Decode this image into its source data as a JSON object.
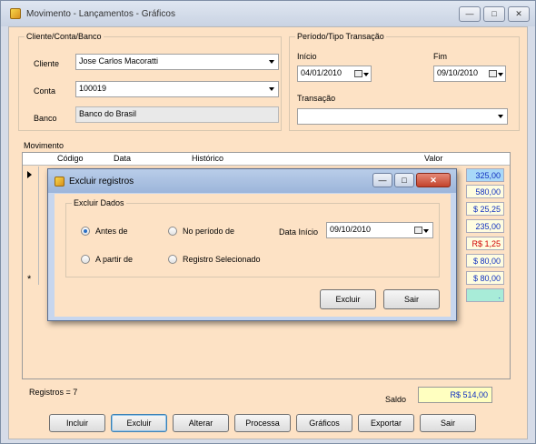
{
  "window": {
    "title": "Movimento - Lançamentos - Gráficos",
    "minimize": "—",
    "maximize": "□",
    "close": "✕"
  },
  "cliente_group": {
    "title": "Cliente/Conta/Banco",
    "cliente_label": "Cliente",
    "cliente_value": "Jose Carlos Macoratti",
    "conta_label": "Conta",
    "conta_value": "100019",
    "banco_label": "Banco",
    "banco_value": "Banco do Brasil"
  },
  "periodo_group": {
    "title": "Período/Tipo Transação",
    "inicio_label": "Início",
    "inicio_value": "04/01/2010",
    "fim_label": "Fim",
    "fim_value": "09/10/2010",
    "transacao_label": "Transação",
    "transacao_value": ""
  },
  "movimento": {
    "title": "Movimento",
    "columns": [
      "Código",
      "Data",
      "Histórico",
      "Valor"
    ],
    "values": [
      "325,00",
      "580,00",
      "$ 25,25",
      "235,00",
      "R$ 1,25",
      "$ 80,00",
      "$ 80,00",
      "."
    ],
    "new_row_marker": "*"
  },
  "footer": {
    "registros": "Registros = 7",
    "saldo_label": "Saldo",
    "saldo_value": "R$ 514,00"
  },
  "buttons": {
    "incluir": "Incluir",
    "excluir": "Excluir",
    "alterar": "Alterar",
    "processa": "Processa",
    "graficos": "Gráficos",
    "exportar": "Exportar",
    "sair": "Sair"
  },
  "dialog": {
    "title": "Excluir registros",
    "minimize": "—",
    "maximize": "□",
    "close": "✕",
    "group_title": "Excluir Dados",
    "antes_de": "Antes de",
    "a_partir_de": "A partir de",
    "no_periodo_de": "No período de",
    "registro_selecionado": "Registro Selecionado",
    "data_inicio_label": "Data Início",
    "data_inicio_value": "09/10/2010",
    "excluir_button": "Excluir",
    "sair_button": "Sair"
  },
  "colors": {
    "form_background": "#fde2c5",
    "saldo_background": "#ffffc0",
    "negative_value": "#d00000",
    "positive_value": "#1030c0",
    "row_highlight": "#a8d8f8"
  }
}
